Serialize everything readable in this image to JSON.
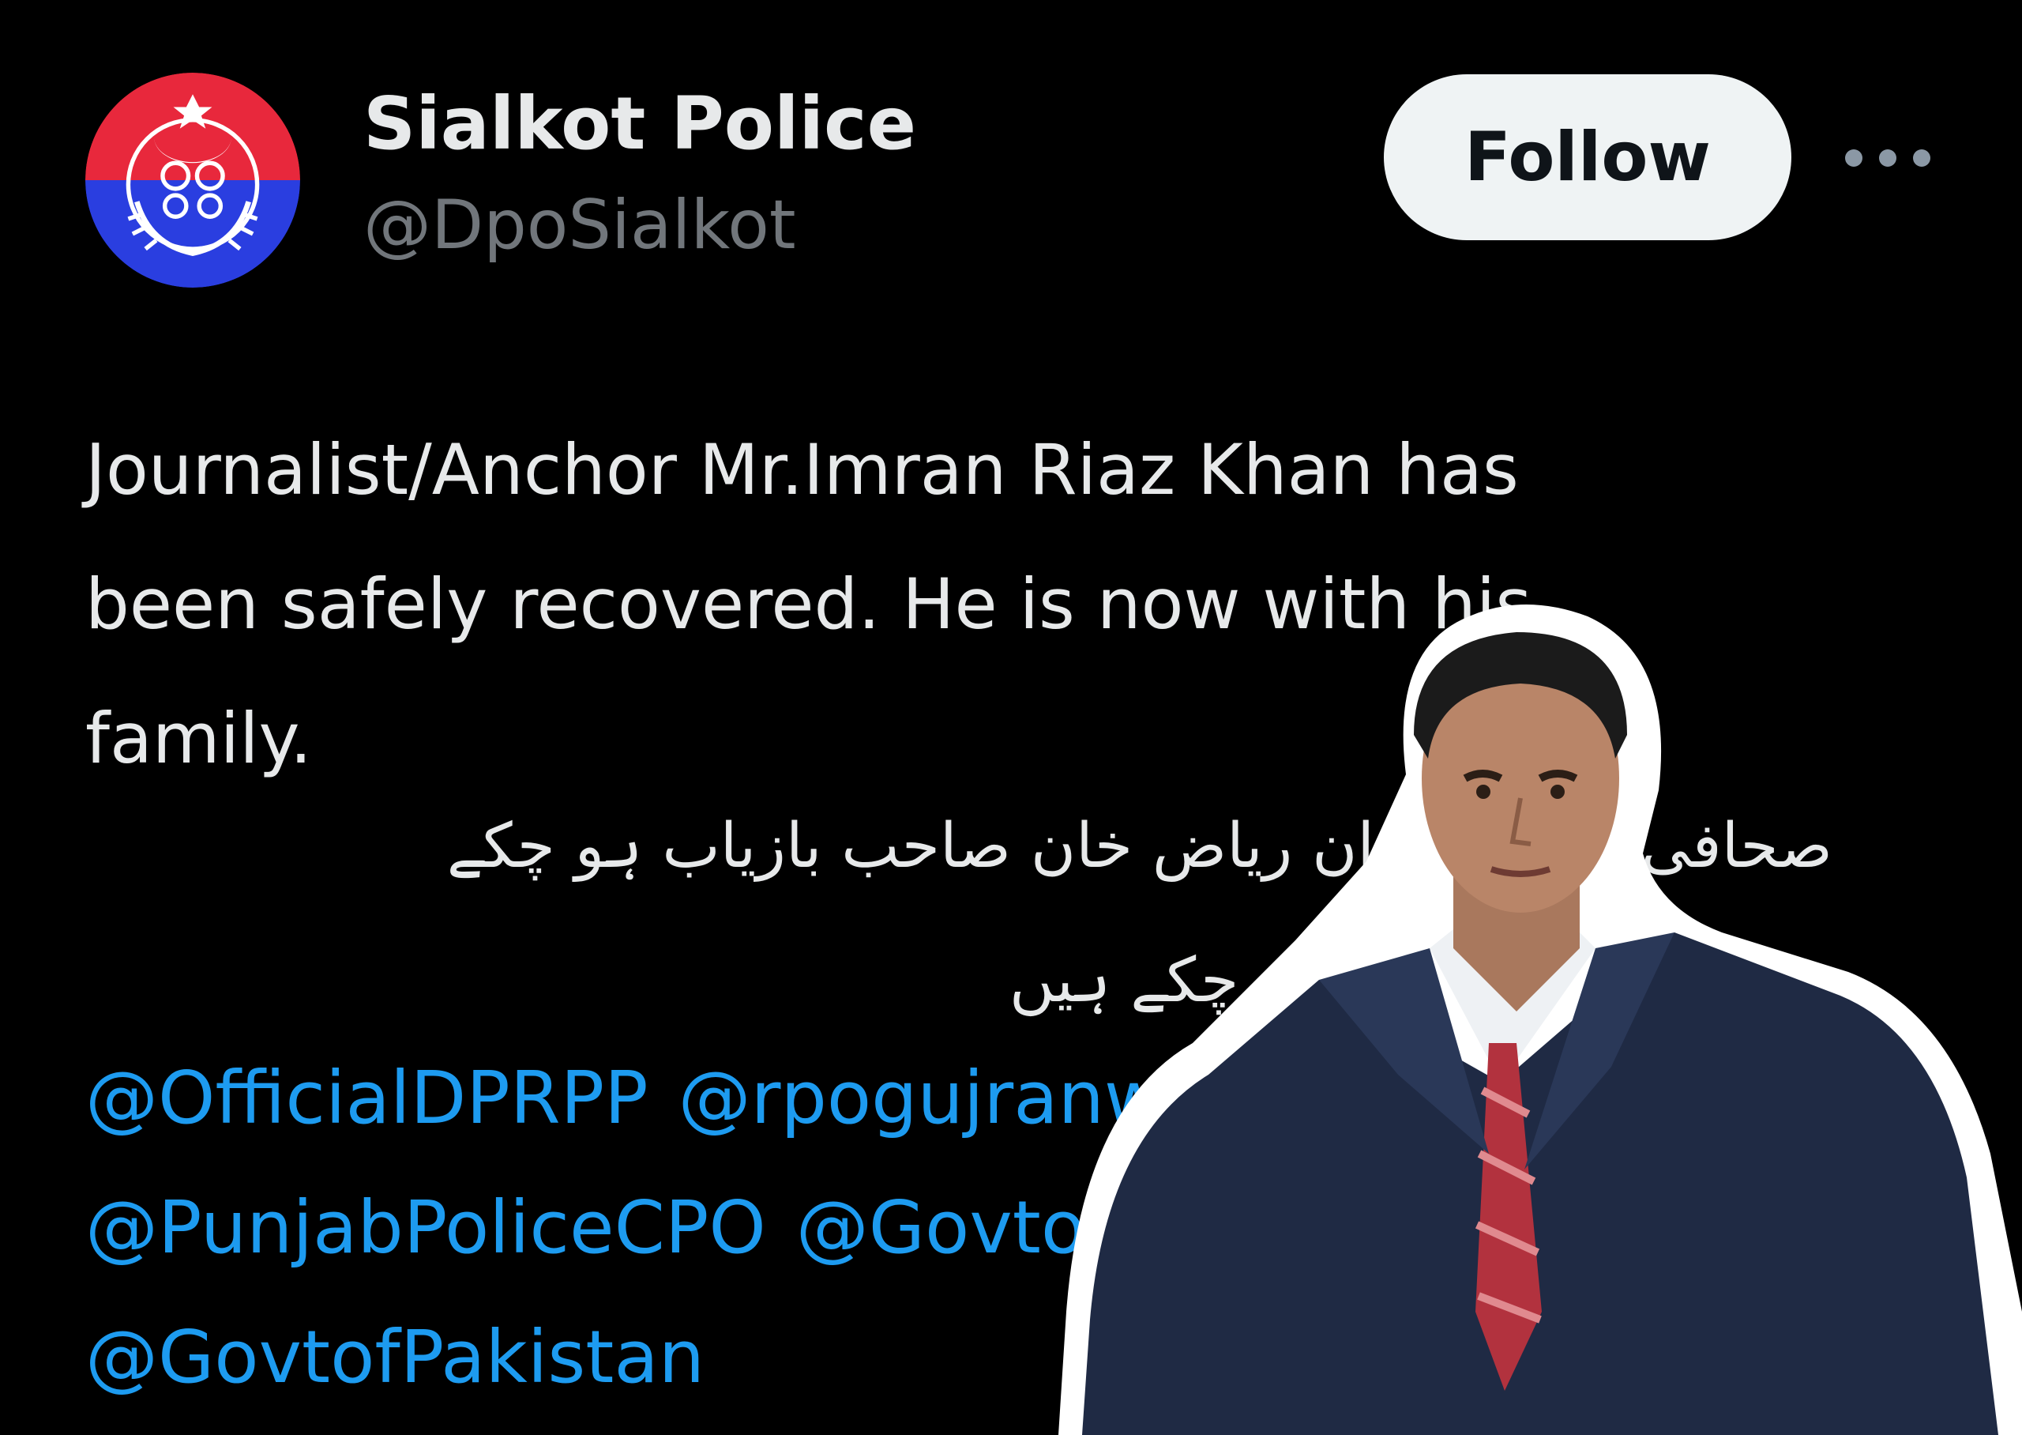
{
  "profile": {
    "display_name": "Sialkot Police",
    "handle": "@DpoSialkot",
    "avatar_icon": "police-emblem-icon"
  },
  "actions": {
    "follow_label": "Follow",
    "more_icon": "more-horizontal-icon"
  },
  "tweet": {
    "english_lines": [
      "Journalist/Anchor Mr.Imran Riaz Khan has",
      "been safely recovered. He is now with his",
      "family."
    ],
    "urdu_lines": [
      "صحافی اینکر عمران ریاض خان صاحب بازیاب ہو چکے",
      "ہیں۔ وہ اپنے گھر پہنچ چکے ہیں"
    ],
    "mention_lines": [
      [
        "@OfficialDPRPP",
        "@rpogujranwala"
      ],
      [
        "@PunjabPoliceCPO",
        "@GovtofPunjab"
      ],
      [
        "@GovtofPakistan"
      ]
    ]
  },
  "colors": {
    "background": "#000000",
    "text": "#e7e9ea",
    "muted": "#71767b",
    "link": "#1d9bf0",
    "button_bg": "#eff3f4",
    "button_text": "#0f1419",
    "emblem_red": "#e8283c",
    "emblem_blue": "#2a3ee0"
  }
}
